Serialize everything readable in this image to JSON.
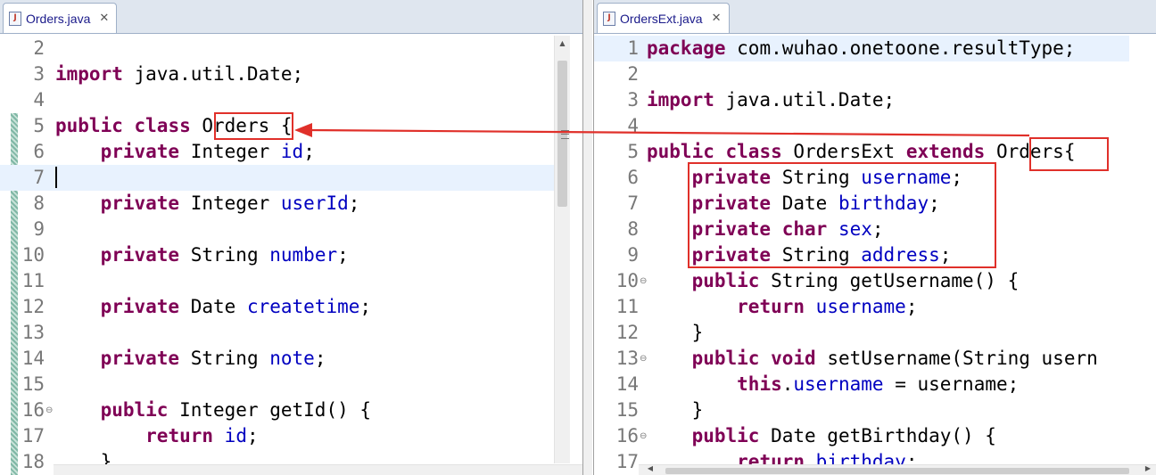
{
  "left_editor": {
    "tab_label": "Orders.java",
    "lines": [
      {
        "n": "2",
        "tokens": []
      },
      {
        "n": "3",
        "tokens": [
          {
            "t": "import",
            "k": "kw"
          },
          {
            "t": " java.util.Date;",
            "k": ""
          }
        ]
      },
      {
        "n": "4",
        "tokens": []
      },
      {
        "n": "5",
        "tokens": [
          {
            "t": "public",
            "k": "kw"
          },
          {
            "t": " ",
            "k": ""
          },
          {
            "t": "class",
            "k": "kw"
          },
          {
            "t": " Orders {",
            "k": ""
          }
        ]
      },
      {
        "n": "6",
        "tokens": [
          {
            "t": "    ",
            "k": ""
          },
          {
            "t": "private",
            "k": "kw"
          },
          {
            "t": " Integer ",
            "k": ""
          },
          {
            "t": "id",
            "k": "fld"
          },
          {
            "t": ";",
            "k": ""
          }
        ]
      },
      {
        "n": "7",
        "tokens": []
      },
      {
        "n": "8",
        "tokens": [
          {
            "t": "    ",
            "k": ""
          },
          {
            "t": "private",
            "k": "kw"
          },
          {
            "t": " Integer ",
            "k": ""
          },
          {
            "t": "userId",
            "k": "fld"
          },
          {
            "t": ";",
            "k": ""
          }
        ]
      },
      {
        "n": "9",
        "tokens": []
      },
      {
        "n": "10",
        "tokens": [
          {
            "t": "    ",
            "k": ""
          },
          {
            "t": "private",
            "k": "kw"
          },
          {
            "t": " String ",
            "k": ""
          },
          {
            "t": "number",
            "k": "fld"
          },
          {
            "t": ";",
            "k": ""
          }
        ]
      },
      {
        "n": "11",
        "tokens": []
      },
      {
        "n": "12",
        "tokens": [
          {
            "t": "    ",
            "k": ""
          },
          {
            "t": "private",
            "k": "kw"
          },
          {
            "t": " Date ",
            "k": ""
          },
          {
            "t": "createtime",
            "k": "fld"
          },
          {
            "t": ";",
            "k": ""
          }
        ]
      },
      {
        "n": "13",
        "tokens": []
      },
      {
        "n": "14",
        "tokens": [
          {
            "t": "    ",
            "k": ""
          },
          {
            "t": "private",
            "k": "kw"
          },
          {
            "t": " String ",
            "k": ""
          },
          {
            "t": "note",
            "k": "fld"
          },
          {
            "t": ";",
            "k": ""
          }
        ]
      },
      {
        "n": "15",
        "tokens": []
      },
      {
        "n": "16",
        "fold": "⊖",
        "tokens": [
          {
            "t": "    ",
            "k": ""
          },
          {
            "t": "public",
            "k": "kw"
          },
          {
            "t": " Integer getId() {",
            "k": ""
          }
        ]
      },
      {
        "n": "17",
        "tokens": [
          {
            "t": "        ",
            "k": ""
          },
          {
            "t": "return",
            "k": "kw"
          },
          {
            "t": " ",
            "k": ""
          },
          {
            "t": "id",
            "k": "fld"
          },
          {
            "t": ";",
            "k": ""
          }
        ]
      },
      {
        "n": "18",
        "tokens": [
          {
            "t": "    }",
            "k": ""
          }
        ]
      }
    ]
  },
  "right_editor": {
    "tab_label": "OrdersExt.java",
    "lines": [
      {
        "n": "1",
        "tokens": [
          {
            "t": "package",
            "k": "kw"
          },
          {
            "t": " com.wuhao.onetoone.resultType;",
            "k": ""
          }
        ]
      },
      {
        "n": "2",
        "tokens": []
      },
      {
        "n": "3",
        "tokens": [
          {
            "t": "import",
            "k": "kw"
          },
          {
            "t": " java.util.Date;",
            "k": ""
          }
        ]
      },
      {
        "n": "4",
        "tokens": []
      },
      {
        "n": "5",
        "tokens": [
          {
            "t": "public",
            "k": "kw"
          },
          {
            "t": " ",
            "k": ""
          },
          {
            "t": "class",
            "k": "kw"
          },
          {
            "t": " OrdersExt ",
            "k": ""
          },
          {
            "t": "extends",
            "k": "kw"
          },
          {
            "t": " Orders{",
            "k": ""
          }
        ]
      },
      {
        "n": "6",
        "tokens": [
          {
            "t": "    ",
            "k": ""
          },
          {
            "t": "private",
            "k": "kw"
          },
          {
            "t": " String ",
            "k": ""
          },
          {
            "t": "username",
            "k": "fld"
          },
          {
            "t": ";",
            "k": ""
          }
        ]
      },
      {
        "n": "7",
        "tokens": [
          {
            "t": "    ",
            "k": ""
          },
          {
            "t": "private",
            "k": "kw"
          },
          {
            "t": " Date ",
            "k": ""
          },
          {
            "t": "birthday",
            "k": "fld"
          },
          {
            "t": ";",
            "k": ""
          }
        ]
      },
      {
        "n": "8",
        "tokens": [
          {
            "t": "    ",
            "k": ""
          },
          {
            "t": "private",
            "k": "kw"
          },
          {
            "t": " ",
            "k": ""
          },
          {
            "t": "char",
            "k": "kw"
          },
          {
            "t": " ",
            "k": ""
          },
          {
            "t": "sex",
            "k": "fld"
          },
          {
            "t": ";",
            "k": ""
          }
        ]
      },
      {
        "n": "9",
        "tokens": [
          {
            "t": "    ",
            "k": ""
          },
          {
            "t": "private",
            "k": "kw"
          },
          {
            "t": " String ",
            "k": ""
          },
          {
            "t": "address",
            "k": "fld"
          },
          {
            "t": ";",
            "k": ""
          }
        ]
      },
      {
        "n": "10",
        "fold": "⊖",
        "tokens": [
          {
            "t": "    ",
            "k": ""
          },
          {
            "t": "public",
            "k": "kw"
          },
          {
            "t": " String getUsername() {",
            "k": ""
          }
        ]
      },
      {
        "n": "11",
        "tokens": [
          {
            "t": "        ",
            "k": ""
          },
          {
            "t": "return",
            "k": "kw"
          },
          {
            "t": " ",
            "k": ""
          },
          {
            "t": "username",
            "k": "fld"
          },
          {
            "t": ";",
            "k": ""
          }
        ]
      },
      {
        "n": "12",
        "tokens": [
          {
            "t": "    }",
            "k": ""
          }
        ]
      },
      {
        "n": "13",
        "fold": "⊖",
        "tokens": [
          {
            "t": "    ",
            "k": ""
          },
          {
            "t": "public",
            "k": "kw"
          },
          {
            "t": " ",
            "k": ""
          },
          {
            "t": "void",
            "k": "kw"
          },
          {
            "t": " setUsername(String usern",
            "k": ""
          }
        ]
      },
      {
        "n": "14",
        "tokens": [
          {
            "t": "        ",
            "k": ""
          },
          {
            "t": "this",
            "k": "kw"
          },
          {
            "t": ".",
            "k": ""
          },
          {
            "t": "username",
            "k": "fld"
          },
          {
            "t": " = username;",
            "k": ""
          }
        ]
      },
      {
        "n": "15",
        "tokens": [
          {
            "t": "    }",
            "k": ""
          }
        ]
      },
      {
        "n": "16",
        "fold": "⊖",
        "tokens": [
          {
            "t": "    ",
            "k": ""
          },
          {
            "t": "public",
            "k": "kw"
          },
          {
            "t": " Date getBirthday() {",
            "k": ""
          }
        ]
      },
      {
        "n": "17",
        "tokens": [
          {
            "t": "        ",
            "k": ""
          },
          {
            "t": "return",
            "k": "kw"
          },
          {
            "t": " ",
            "k": ""
          },
          {
            "t": "birthday",
            "k": "fld"
          },
          {
            "t": ";",
            "k": ""
          }
        ]
      }
    ]
  },
  "icons": {
    "file": "java-file-icon",
    "close": "close-icon",
    "scroll_up": "scroll-up-arrow-icon",
    "scroll_left": "scroll-left-arrow-icon",
    "scroll_right": "scroll-right-arrow-icon"
  },
  "colors": {
    "keyword": "#7f0055",
    "field": "#0000c0",
    "annotation": "#e0302a",
    "current_line": "#e8f2fe"
  }
}
